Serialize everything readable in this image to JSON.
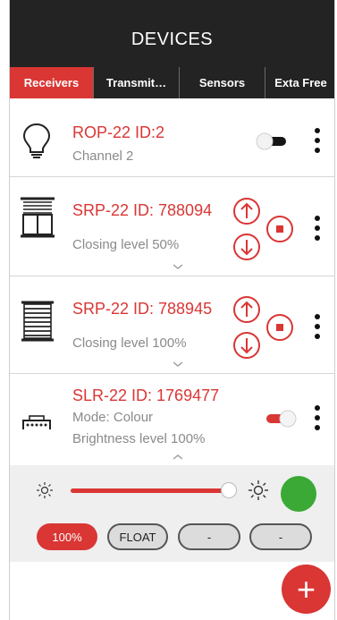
{
  "header": {
    "title": "DEVICES"
  },
  "tabs": [
    {
      "label": "Receivers",
      "active": true
    },
    {
      "label": "Transmit…",
      "active": false
    },
    {
      "label": "Sensors",
      "active": false
    },
    {
      "label": "Exta Free",
      "active": false
    }
  ],
  "devices": [
    {
      "name": "ROP-22 ID:2",
      "detail": "Channel 2",
      "icon": "light-bulb-icon",
      "toggle_on": false
    },
    {
      "name": "SRP-22 ID: 788094",
      "detail": "Closing level 50%",
      "icon": "window-blind-icon"
    },
    {
      "name": "SRP-22 ID: 788945",
      "detail": "Closing level 100%",
      "icon": "roller-shutter-icon"
    },
    {
      "name": "SLR-22 ID: 1769477",
      "mode": "Mode: Colour",
      "detail": "Brightness level 100%",
      "icon": "led-strip-icon",
      "toggle_on": true
    }
  ],
  "controls": {
    "brightness_level": 1.0,
    "selected_color": "#3ba935",
    "presets": [
      "100%",
      "FLOAT",
      "-",
      "-"
    ]
  },
  "colors": {
    "accent": "#d93634",
    "header_bg": "#232323"
  },
  "fab": {
    "label": "+"
  }
}
